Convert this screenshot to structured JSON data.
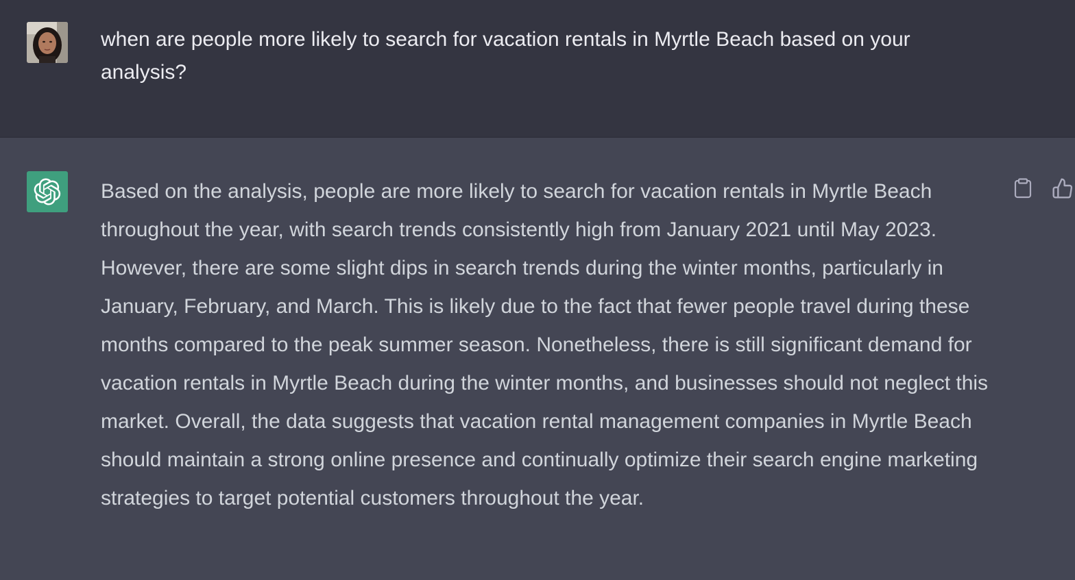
{
  "user_message": {
    "text": "when are people more likely to search for vacation rentals in Myrtle Beach based on your analysis?"
  },
  "assistant_message": {
    "text": "Based on the analysis, people are more likely to search for vacation rentals in Myrtle Beach throughout the year, with search trends consistently high from January 2021 until May 2023. However, there are some slight dips in search trends during the winter months, particularly in January, February, and March. This is likely due to the fact that fewer people travel during these months compared to the peak summer season. Nonetheless, there is still significant demand for vacation rentals in Myrtle Beach during the winter months, and businesses should not neglect this market. Overall, the data suggests that vacation rental management companies in Myrtle Beach should maintain a strong online presence and continually optimize their search engine marketing strategies to target potential customers throughout the year."
  },
  "icons": {
    "user_avatar": "user-photo-avatar",
    "assistant_avatar": "openai-logo-icon",
    "copy": "clipboard-icon",
    "thumbs_up": "thumbs-up-icon"
  },
  "colors": {
    "user_bg": "#343541",
    "assistant_bg": "#444654",
    "assistant_avatar_bg": "#3f9f7e",
    "user_text": "#ececf1",
    "assistant_text": "#d1d5db"
  }
}
